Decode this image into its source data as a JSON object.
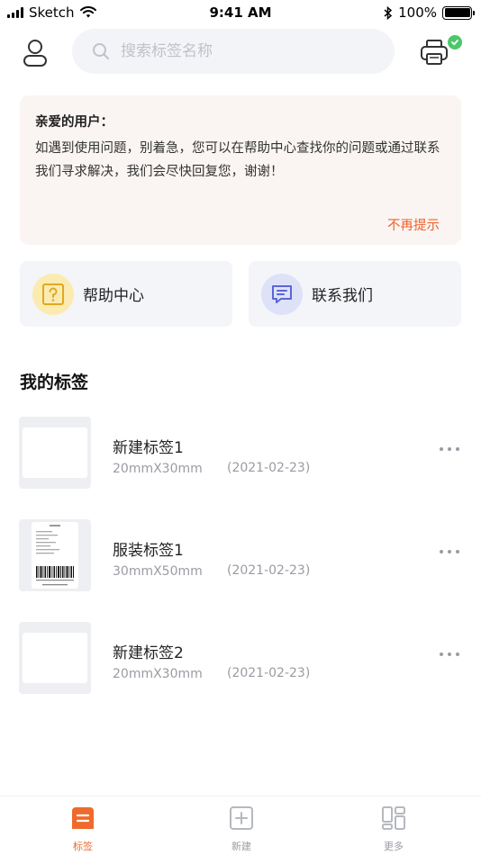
{
  "status_bar": {
    "carrier": "Sketch",
    "time": "9:41 AM",
    "battery": "100%"
  },
  "search": {
    "placeholder": "搜索标签名称"
  },
  "notice": {
    "title": "亲爱的用户：",
    "body": "如遇到使用问题，别着急，您可以在帮助中心查找你的问题或通过联系我们寻求解决，我们会尽快回复您，谢谢！",
    "dismiss": "不再提示"
  },
  "actions": {
    "help": "帮助中心",
    "contact": "联系我们"
  },
  "section": {
    "title": "我的标签"
  },
  "labels": [
    {
      "name": "新建标签1",
      "size": "20mmX30mm",
      "date": "(2021-02-23)",
      "thumb": "blank"
    },
    {
      "name": "服装标签1",
      "size": "30mmX50mm",
      "date": "(2021-02-23)",
      "thumb": "barcode-tag"
    },
    {
      "name": "新建标签2",
      "size": "20mmX30mm",
      "date": "(2021-02-23)",
      "thumb": "blank"
    }
  ],
  "tabs": [
    {
      "label": "标签",
      "icon": "label-icon",
      "active": true
    },
    {
      "label": "新建",
      "icon": "plus-square-icon",
      "active": false
    },
    {
      "label": "更多",
      "icon": "grid-icon",
      "active": false
    }
  ],
  "colors": {
    "accent": "#f06a2b",
    "notice_bg": "#faf5f3",
    "status_ok": "#4cc76a"
  }
}
